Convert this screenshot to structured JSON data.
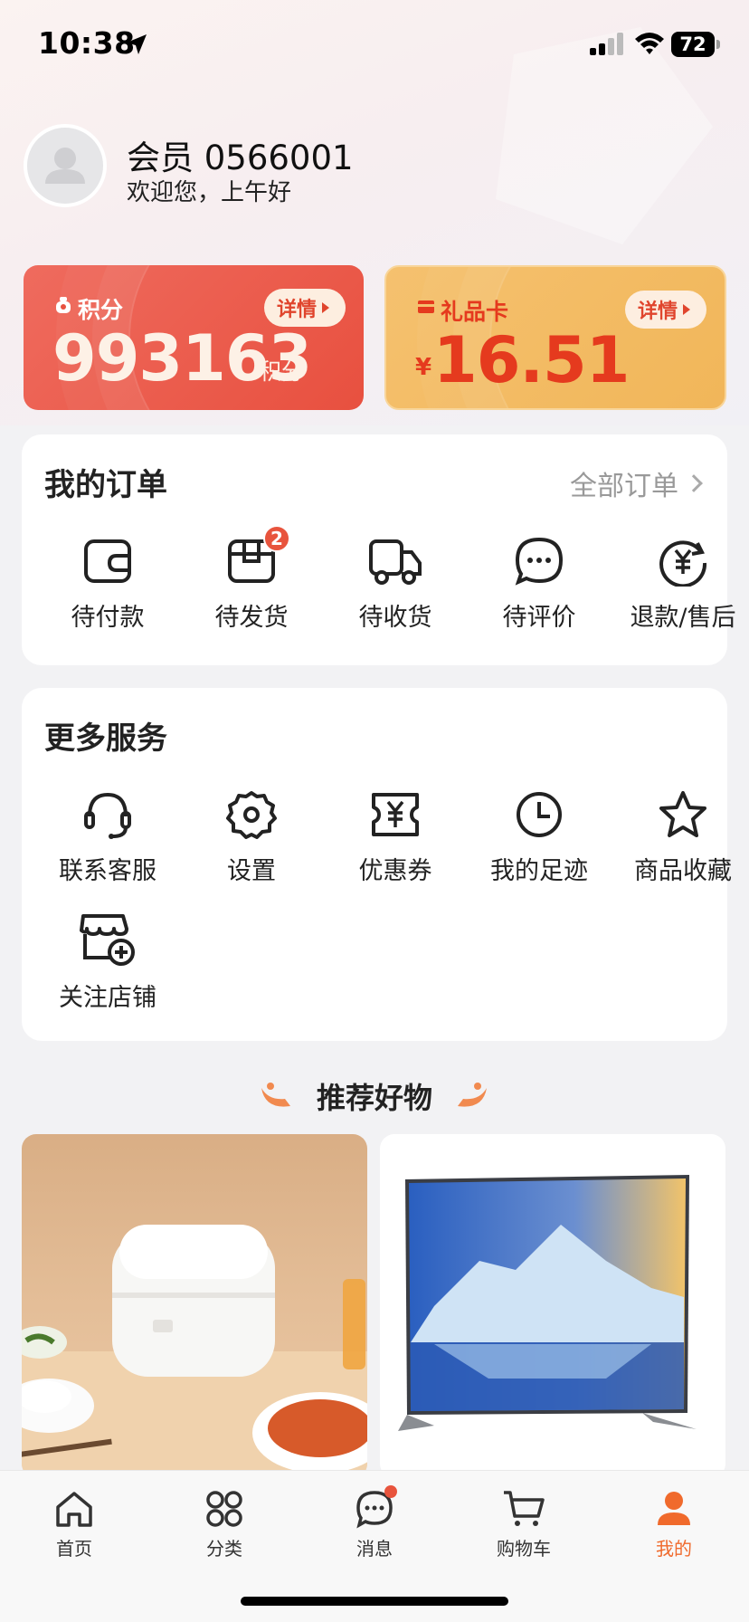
{
  "status_bar": {
    "time": "10:38",
    "battery": "72"
  },
  "profile": {
    "member_name": "会员 0566001",
    "greeting": "欢迎您，上午好"
  },
  "points_card": {
    "label": "积分",
    "detail": "详情",
    "value": "993163",
    "unit": "积分"
  },
  "gift_card": {
    "label": "礼品卡",
    "detail": "详情",
    "currency": "¥",
    "value": "16.51"
  },
  "orders": {
    "title": "我的订单",
    "all_orders": "全部订单",
    "items": [
      {
        "label": "待付款",
        "icon": "wallet-icon"
      },
      {
        "label": "待发货",
        "icon": "box-icon",
        "badge": "2"
      },
      {
        "label": "待收货",
        "icon": "truck-icon"
      },
      {
        "label": "待评价",
        "icon": "chat-icon"
      },
      {
        "label": "退款/售后",
        "icon": "refund-icon"
      }
    ]
  },
  "services": {
    "title": "更多服务",
    "items": [
      {
        "label": "联系客服",
        "icon": "headset-icon"
      },
      {
        "label": "设置",
        "icon": "gear-icon"
      },
      {
        "label": "优惠券",
        "icon": "coupon-icon"
      },
      {
        "label": "我的足迹",
        "icon": "clock-icon"
      },
      {
        "label": "商品收藏",
        "icon": "star-icon"
      },
      {
        "label": "关注店铺",
        "icon": "store-add-icon"
      }
    ]
  },
  "recommend": {
    "title": "推荐好物"
  },
  "tab_bar": {
    "items": [
      {
        "label": "首页",
        "icon": "home-icon"
      },
      {
        "label": "分类",
        "icon": "category-icon"
      },
      {
        "label": "消息",
        "icon": "message-icon"
      },
      {
        "label": "购物车",
        "icon": "cart-icon"
      },
      {
        "label": "我的",
        "icon": "profile-icon",
        "active": true
      }
    ]
  },
  "colors": {
    "accent": "#f06a2c",
    "points_card": "#e8503f",
    "gift_card": "#f1b659",
    "badge": "#e8543d"
  }
}
